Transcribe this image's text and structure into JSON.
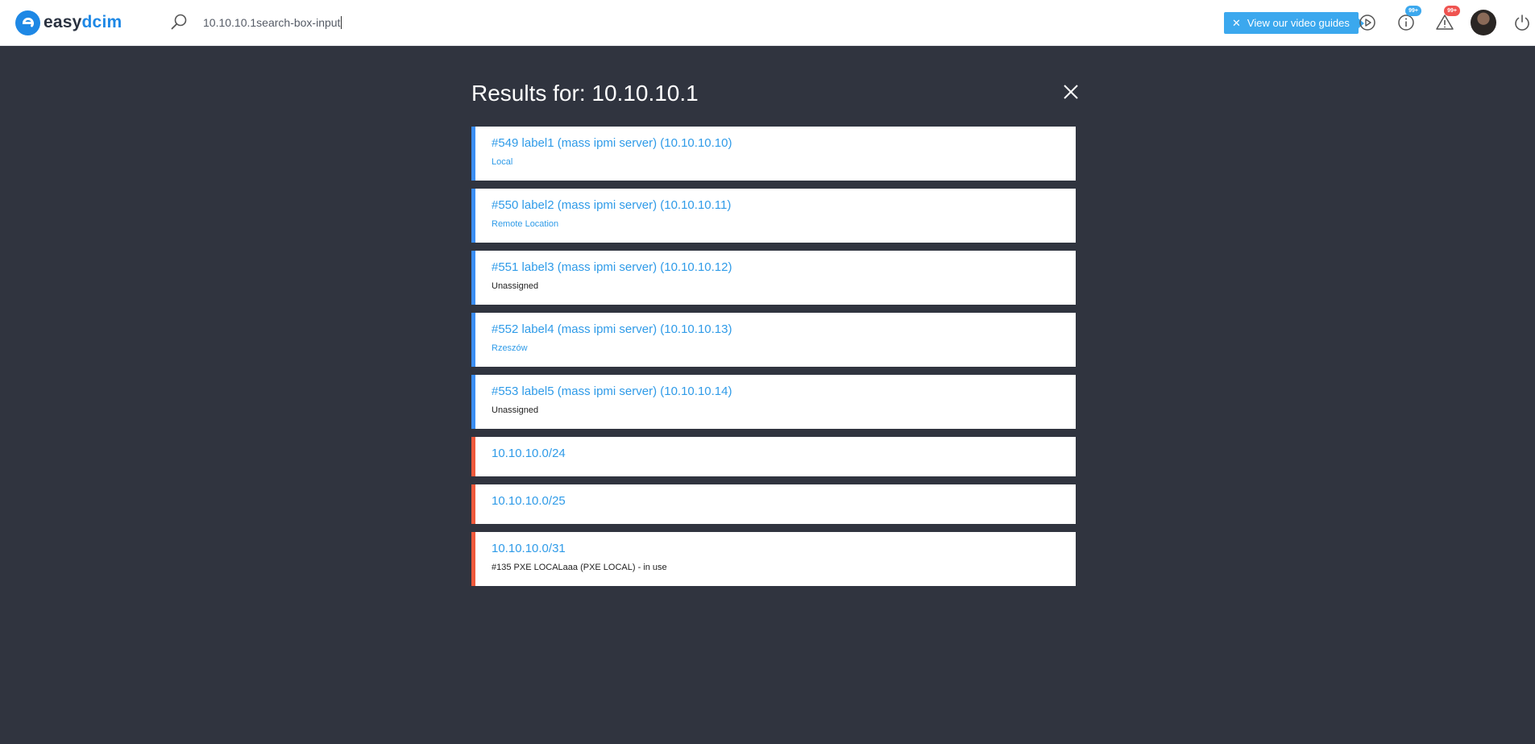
{
  "header": {
    "logo": {
      "part1": "easy",
      "part2": "dcim"
    },
    "search": {
      "value": "10.10.10.1search-box-input",
      "icon": "search-icon"
    },
    "video_guides": {
      "label": "View our video guides",
      "close_icon": "close-icon"
    },
    "icons": [
      {
        "name": "play-icon"
      },
      {
        "name": "info-icon",
        "badge": "99+"
      },
      {
        "name": "warning-icon",
        "badge": "99+"
      }
    ],
    "avatar": "user-avatar",
    "power": "power-icon"
  },
  "results": {
    "title": "Results for: 10.10.10.1",
    "items": [
      {
        "title": "#549 label1 (mass ipmi server) (10.10.10.10)",
        "sub": "Local",
        "sub_style": "link",
        "accent": "#3b8ef3"
      },
      {
        "title": "#550 label2 (mass ipmi server) (10.10.10.11)",
        "sub": "Remote Location",
        "sub_style": "link",
        "accent": "#3b8ef3"
      },
      {
        "title": "#551 label3 (mass ipmi server) (10.10.10.12)",
        "sub": "Unassigned",
        "sub_style": "plain",
        "accent": "#3b8ef3"
      },
      {
        "title": "#552 label4 (mass ipmi server) (10.10.10.13)",
        "sub": "Rzeszów",
        "sub_style": "link",
        "accent": "#3b8ef3"
      },
      {
        "title": "#553 label5 (mass ipmi server) (10.10.10.14)",
        "sub": "Unassigned",
        "sub_style": "plain",
        "accent": "#3b8ef3"
      },
      {
        "title": "10.10.10.0/24",
        "sub": "",
        "accent": "#ef5a3c"
      },
      {
        "title": "10.10.10.0/25",
        "sub": "",
        "accent": "#ef5a3c"
      },
      {
        "title": "10.10.10.0/31",
        "sub": "#135 PXE LOCALaaa (PXE LOCAL) - in use",
        "sub_style": "plain",
        "accent": "#ef5a3c"
      }
    ]
  },
  "colors": {
    "background": "#30343f",
    "accent_blue": "#3b8ef3",
    "accent_red": "#ef5a3c",
    "link": "#2f9be8"
  }
}
